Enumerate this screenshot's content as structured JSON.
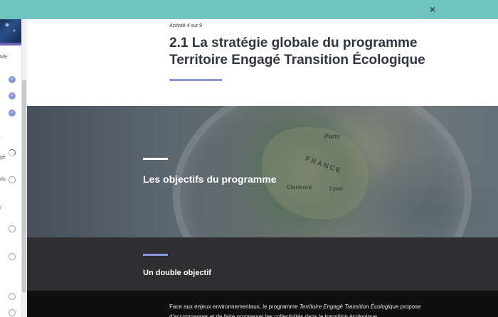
{
  "topbar": {
    "close_icon": "close-icon",
    "close_glyph": "×"
  },
  "sidebar": {
    "fragments": [
      {
        "text": "ME"
      },
      {
        "text": "gé"
      },
      {
        "text": "du"
      },
      {
        "text": "/"
      }
    ],
    "check_glyph": "✓"
  },
  "lesson": {
    "counter": "Activité 4 sur 9",
    "title": "2.1 La stratégie globale du programme Territoire Engagé Transition Écologique"
  },
  "hero": {
    "heading": "Les objectifs du programme",
    "map_labels": {
      "paris": "Paris",
      "france": "FRANCE",
      "clermont": "Clermont",
      "lyon": "Lyon"
    }
  },
  "section": {
    "heading": "Un double objectif"
  },
  "body": {
    "text_before": "Face aux enjeux environnementaux, le programme ",
    "text_emphasis": "Territoire Engagé Transition Écologique",
    "text_after": " propose d'accompagner et de faire progresser les collectivités dans la transition écologique"
  }
}
